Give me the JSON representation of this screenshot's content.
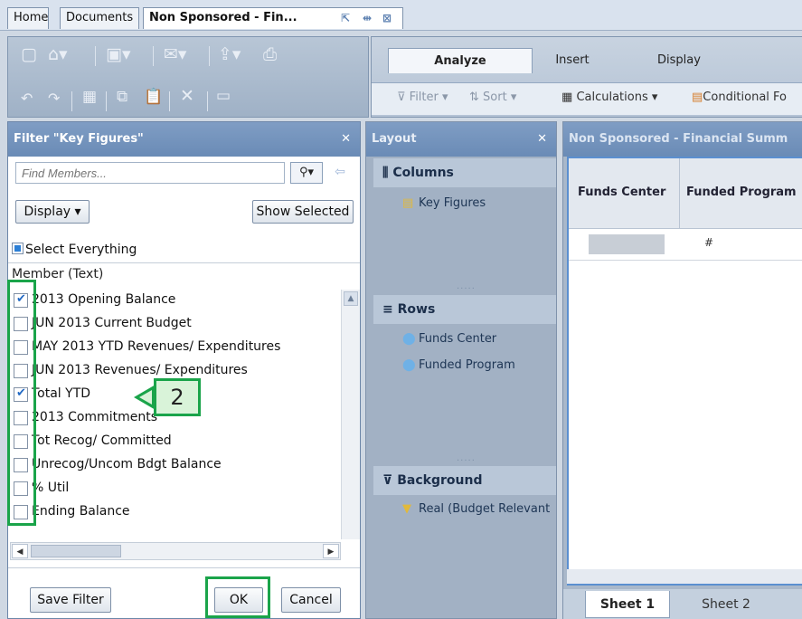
{
  "tabs": {
    "home": "Home",
    "documents": "Documents",
    "document": "Non Sponsored - Fin..."
  },
  "ribbon": {
    "tabs": [
      "Analyze",
      "Insert",
      "Display"
    ],
    "filter": "Filter",
    "sort": "Sort",
    "calculations": "Calculations",
    "conditional": "Conditional Fo"
  },
  "filter_dialog": {
    "title": "Filter \"Key Figures\"",
    "find_placeholder": "Find Members...",
    "display_label": "Display",
    "show_selected_label": "Show Selected",
    "select_everything": "Select Everything",
    "member_header": "Member (Text)",
    "members": [
      {
        "label": "2013 Opening Balance",
        "checked": true
      },
      {
        "label": "JUN 2013 Current  Budget",
        "checked": false
      },
      {
        "label": "MAY 2013 YTD  Revenues/ Expenditures",
        "checked": false
      },
      {
        "label": "JUN 2013 Revenues/ Expenditures",
        "checked": false
      },
      {
        "label": "Total YTD",
        "checked": true
      },
      {
        "label": "2013 Commitments",
        "checked": false
      },
      {
        "label": "Tot Recog/ Committed",
        "checked": false
      },
      {
        "label": "Unrecog/Uncom Bdgt Balance",
        "checked": false
      },
      {
        "label": " % Util",
        "checked": false
      },
      {
        "label": "Ending Balance",
        "checked": false
      }
    ],
    "save_filter_label": "Save Filter",
    "ok_label": "OK",
    "cancel_label": "Cancel"
  },
  "callout": {
    "number": "2"
  },
  "layout_panel": {
    "title": "Layout",
    "columns_label": "Columns",
    "columns_items": [
      "Key Figures"
    ],
    "rows_label": "Rows",
    "rows_items": [
      "Funds Center",
      "Funded Program"
    ],
    "background_label": "Background",
    "background_items": [
      "Real (Budget Relevant"
    ]
  },
  "grid": {
    "title": "Non Sponsored - Financial Summ",
    "col1": "Funds Center",
    "col2": "Funded Program",
    "cell_hash": "#",
    "sheets": [
      "Sheet 1",
      "Sheet 2"
    ]
  },
  "colors": {
    "highlight": "#1aa44a",
    "header": "#6a8bb6",
    "check": "#2269c4"
  }
}
